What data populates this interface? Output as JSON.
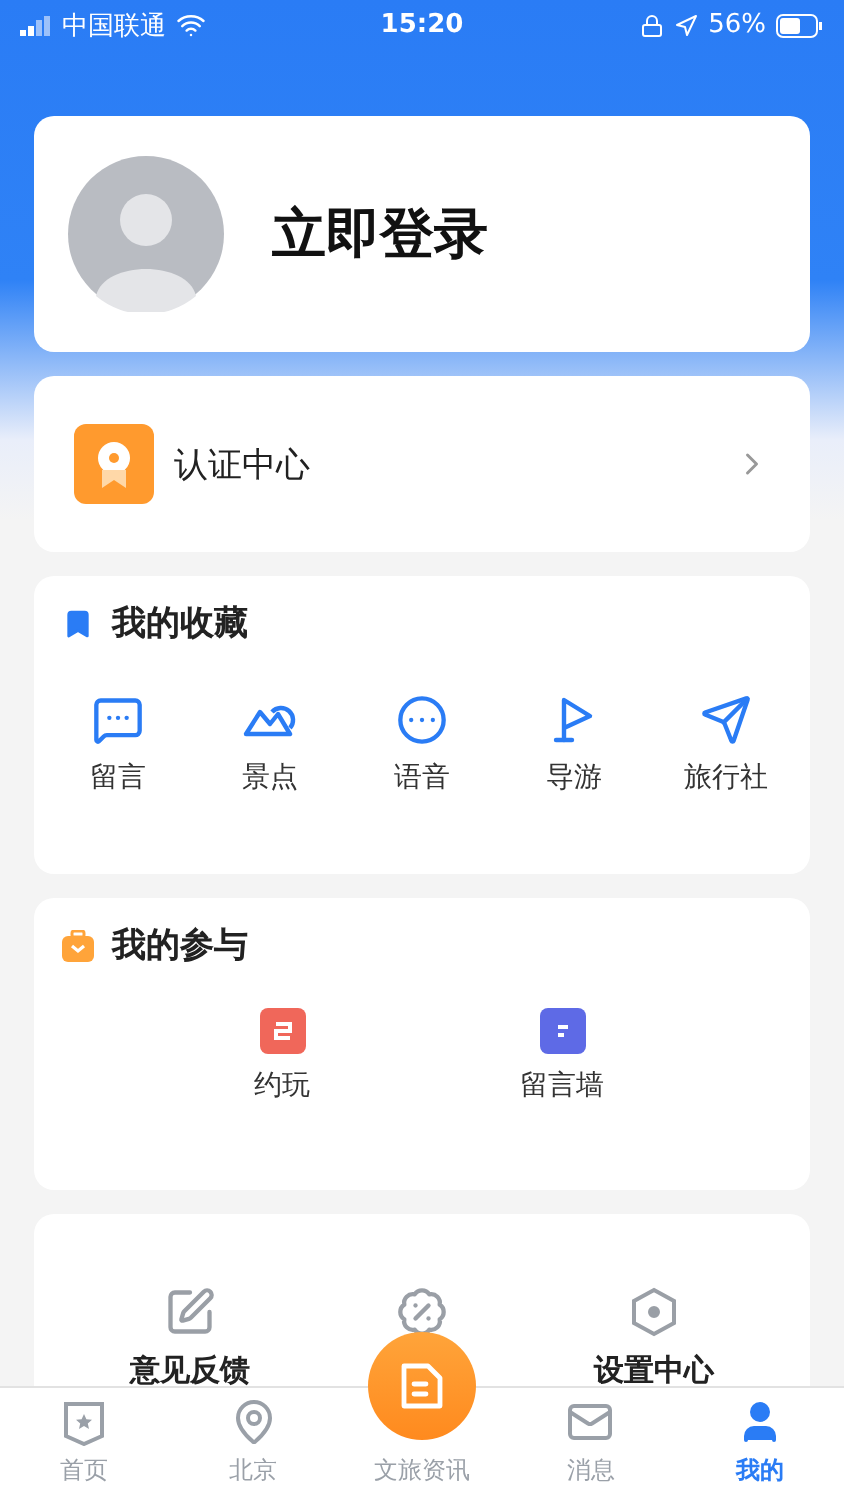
{
  "status_bar": {
    "carrier": "中国联通",
    "time": "15:20",
    "battery": "56%"
  },
  "profile": {
    "login": "立即登录"
  },
  "certification": {
    "label": "认证中心"
  },
  "favorites": {
    "title": "我的收藏",
    "items": [
      {
        "label": "留言",
        "kind": "message"
      },
      {
        "label": "景点",
        "kind": "scenery"
      },
      {
        "label": "语音",
        "kind": "voice"
      },
      {
        "label": "导游",
        "kind": "guide"
      },
      {
        "label": "旅行社",
        "kind": "agency"
      }
    ]
  },
  "participation": {
    "title": "我的参与",
    "items": [
      {
        "label": "约玩",
        "color": "#f0675a"
      },
      {
        "label": "留言墙",
        "color": "#5e6ae6"
      }
    ]
  },
  "services": {
    "items": [
      {
        "label": "意见反馈",
        "kind": "feedback"
      },
      {
        "kind": "activity"
      },
      {
        "label": "设置中心",
        "kind": "settings"
      }
    ]
  },
  "tab_bar": {
    "items": [
      {
        "label": "首页",
        "kind": "home",
        "selected": false
      },
      {
        "label": "北京",
        "kind": "city",
        "selected": false
      },
      {
        "label": "文旅资讯",
        "kind": "news",
        "selected": false
      },
      {
        "label": "消息",
        "kind": "messages",
        "selected": false
      },
      {
        "label": "我的",
        "kind": "me",
        "selected": true
      }
    ]
  }
}
